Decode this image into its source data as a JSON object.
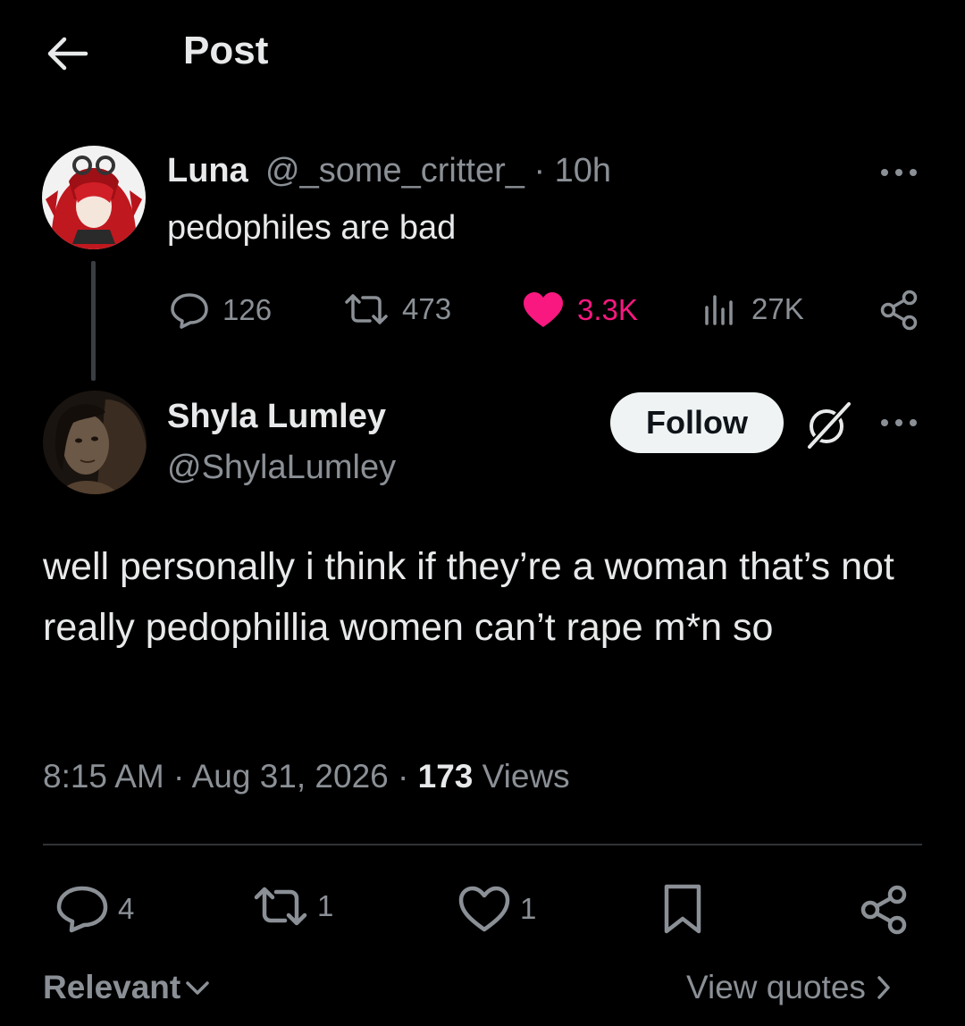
{
  "header": {
    "title": "Post",
    "back_icon": "arrow-left-icon"
  },
  "parent_post": {
    "author_name": "Luna",
    "handle_time": "@_some_critter_ · 10h",
    "text": "pedophiles are bad",
    "stats": {
      "replies": "126",
      "reposts": "473",
      "likes": "3.3K",
      "views": "27K"
    },
    "like_color": "#f91880",
    "liked": true
  },
  "main_post": {
    "author_name": "Shyla Lumley",
    "handle": "@ShylaLumley",
    "follow_label": "Follow",
    "text": "well personally i think if they’re a woman that’s not really pedophillia women can’t rape m*n so",
    "timestamp": "8:15 AM · Aug 31, 2026 · ",
    "views_count": "173",
    "views_label": " Views",
    "stats": {
      "replies": "4",
      "reposts": "1",
      "likes": "1"
    }
  },
  "footer": {
    "sort_label": "Relevant",
    "view_quotes_label": "View quotes"
  },
  "colors": {
    "background": "#000000",
    "text": "#e7e9ea",
    "secondary": "#8b9096",
    "divider": "#2f3336",
    "button_bg": "#eff3f4"
  }
}
